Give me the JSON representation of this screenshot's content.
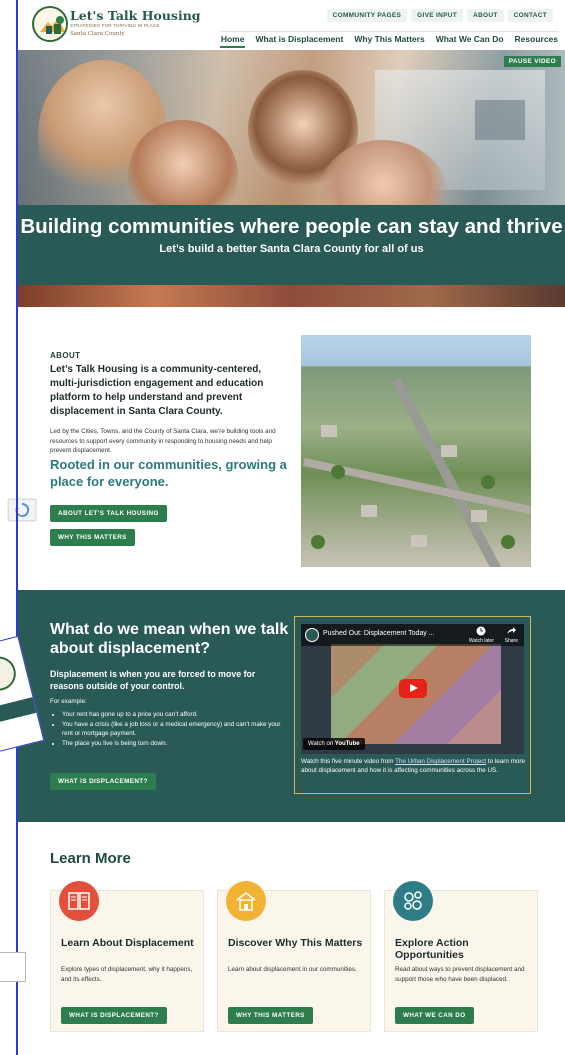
{
  "brand": {
    "title": "Let's Talk Housing",
    "tagline": "STRATEGIES FOR THRIVING IN PLACE",
    "county": "Santa Clara County"
  },
  "utility_nav": [
    "COMMUNITY PAGES",
    "GIVE INPUT",
    "ABOUT",
    "CONTACT"
  ],
  "main_nav": [
    {
      "label": "Home",
      "active": true
    },
    {
      "label": "What is Displacement"
    },
    {
      "label": "Why This Matters"
    },
    {
      "label": "What We Can Do"
    },
    {
      "label": "Resources"
    }
  ],
  "hero": {
    "pause_label": "PAUSE VIDEO",
    "title": "Building communities where people can stay and thrive",
    "subtitle": "Let’s build a better Santa Clara County for all of us"
  },
  "about": {
    "eyebrow": "ABOUT",
    "lead": "Let’s Talk Housing is a community-centered, multi-jurisdiction engagement and education platform to help understand and prevent displacement in Santa Clara County.",
    "body": "Led by the Cities, Towns, and the County of Santa Clara, we’re building tools and resources to support every community in responding to housing needs and help prevent displacement.",
    "tagline": "Rooted in our communities, growing a place for everyone.",
    "button1": "ABOUT LET’S TALK HOUSING",
    "button2": "WHY THIS MATTERS"
  },
  "displacement": {
    "title": "What do we mean when we talk about displacement?",
    "lead": "Displacement is when you are forced to move for reasons outside of your control.",
    "example_label": "For example:",
    "examples": [
      "Your rent has gone up to a price you can’t afford.",
      "You have a crisis (like a job loss or a medical emergency) and can’t make your rent or mortgage payment.",
      "The place you live is being torn down."
    ],
    "button": "WHAT IS DISPLACEMENT?",
    "video": {
      "logo_text": "URBAN DISPLA",
      "title": "Pushed Out: Displacement Today ...",
      "watch_later": "Watch later",
      "share": "Share",
      "watch_on": "Watch on",
      "youtube": "YouTube"
    },
    "caption_pre": "Watch this five minute video from ",
    "caption_link": "The Urban Displacement Project",
    "caption_post": " to learn more about displacement and how it is affecting communities across the US."
  },
  "learn_more": {
    "title": "Learn More",
    "cards": [
      {
        "title": "Learn About Displacement",
        "body": "Explore types of displacement, why it happens, and its effects.",
        "button": "WHAT IS DISPLACEMENT?",
        "icon": "book-icon",
        "color": "#e2503a"
      },
      {
        "title": "Discover Why This Matters",
        "body": "Learn about displacement in our communities.",
        "button": "WHY THIS MATTERS",
        "icon": "house-icon",
        "color": "#f2b233"
      },
      {
        "title": "Explore Action Opportunities",
        "body": "Read about ways to prevent displacement and support those who have been displaced.",
        "button": "WHAT WE CAN DO",
        "icon": "gears-icon",
        "color": "#2e7d86"
      }
    ]
  }
}
